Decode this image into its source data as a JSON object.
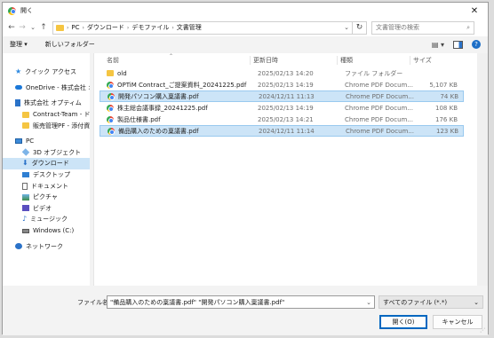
{
  "window": {
    "title": "開く",
    "close_glyph": "✕"
  },
  "nav": {
    "back": "←",
    "forward": "→",
    "recent": "⌄",
    "up": "↑",
    "breadcrumb": [
      "PC",
      "ダウンロード",
      "デモファイル",
      "文書管理"
    ],
    "refresh": "↻",
    "search_placeholder": "文書管理の検索",
    "search_icon": "⌕"
  },
  "toolbar": {
    "organize": "整理 ▾",
    "new_folder": "新しいフォルダー",
    "view_glyph": "▤ ▾",
    "help": "?"
  },
  "sidebar": {
    "items": [
      {
        "label": "クイック アクセス",
        "icon": "star-icon"
      },
      {
        "label": "OneDrive - 株式会社 オ",
        "icon": "cloud-icon"
      },
      {
        "label": "株式会社 オプティム",
        "icon": "building-icon"
      },
      {
        "label": "Contract-Team - ドキュ",
        "icon": "folder-icon"
      },
      {
        "label": "販売管理PF - 添付資料",
        "icon": "folder-icon"
      },
      {
        "label": "PC",
        "icon": "pc-icon"
      },
      {
        "label": "3D オブジェクト",
        "icon": "cube-icon"
      },
      {
        "label": "ダウンロード",
        "icon": "download-icon"
      },
      {
        "label": "デスクトップ",
        "icon": "desktop-icon"
      },
      {
        "label": "ドキュメント",
        "icon": "document-icon"
      },
      {
        "label": "ピクチャ",
        "icon": "pictures-icon"
      },
      {
        "label": "ビデオ",
        "icon": "video-icon"
      },
      {
        "label": "ミュージック",
        "icon": "music-icon"
      },
      {
        "label": "Windows (C:)",
        "icon": "drive-icon"
      },
      {
        "label": "ネットワーク",
        "icon": "network-icon"
      }
    ]
  },
  "columns": {
    "name": "名前",
    "date": "更新日時",
    "type": "種類",
    "size": "サイズ"
  },
  "files": [
    {
      "name": "old",
      "date": "2025/02/13 14:20",
      "type": "ファイル フォルダー",
      "size": ""
    },
    {
      "name": "OPTiM Contract_ご提案資料_20241225.pdf",
      "date": "2025/02/13 14:19",
      "type": "Chrome PDF Docum...",
      "size": "5,107 KB"
    },
    {
      "name": "開発パソコン購入稟議書.pdf",
      "date": "2024/12/11 11:13",
      "type": "Chrome PDF Docum...",
      "size": "74 KB"
    },
    {
      "name": "株主総会議事録_20241225.pdf",
      "date": "2025/02/13 14:19",
      "type": "Chrome PDF Docum...",
      "size": "108 KB"
    },
    {
      "name": "製品仕様書.pdf",
      "date": "2025/02/13 14:21",
      "type": "Chrome PDF Docum...",
      "size": "176 KB"
    },
    {
      "name": "備品購入のための稟議書.pdf",
      "date": "2024/12/11 11:14",
      "type": "Chrome PDF Docum...",
      "size": "123 KB"
    }
  ],
  "bottom": {
    "filename_label": "ファイル名(N):",
    "filename_value": "\"備品購入のための稟議書.pdf\" \"開発パソコン購入稟議書.pdf\"",
    "filetype": "すべてのファイル (*.*)",
    "open": "開く(O)",
    "cancel": "キャンセル"
  }
}
